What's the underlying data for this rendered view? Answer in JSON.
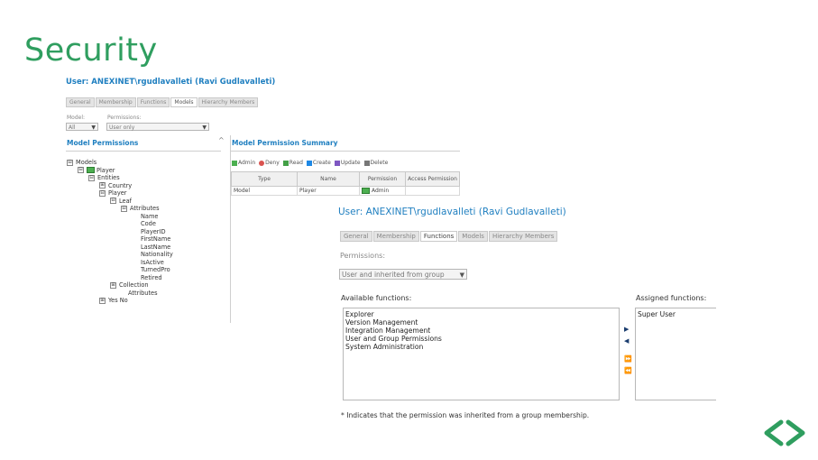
{
  "slide": {
    "title": "Security"
  },
  "screenshot1": {
    "user_title": "User: ANEXINET\\rgudlavalleti (Ravi Gudlavalleti)",
    "tabs": [
      "General",
      "Membership",
      "Functions",
      "Models",
      "Hierarchy Members"
    ],
    "model_label": "Model:",
    "model_value": "All",
    "permissions_label": "Permissions:",
    "permissions_value": "User only",
    "left_title": "Model Permissions",
    "right_title": "Model Permission Summary",
    "legend": [
      {
        "label": "Admin",
        "color": "#4caf50"
      },
      {
        "label": "Deny",
        "color": "#d9534f"
      },
      {
        "label": "Read",
        "color": "#43a047"
      },
      {
        "label": "Create",
        "color": "#1e88e5"
      },
      {
        "label": "Update",
        "color": "#7e57c2"
      },
      {
        "label": "Delete",
        "color": "#777777"
      }
    ],
    "tree": [
      {
        "label": "Models",
        "toggle": "⊟",
        "icon": false
      },
      {
        "label": "Player",
        "toggle": "⊟",
        "icon": true
      },
      {
        "label": "Entities",
        "toggle": "⊟",
        "icon": false
      },
      {
        "label": "Country",
        "toggle": "⊞",
        "icon": false
      },
      {
        "label": "Player",
        "toggle": "⊟",
        "icon": false
      },
      {
        "label": "Leaf",
        "toggle": "⊟",
        "icon": false
      },
      {
        "label": "Attributes",
        "toggle": "⊟",
        "icon": false
      },
      {
        "label": "Name",
        "toggle": "",
        "icon": false
      },
      {
        "label": "Code",
        "toggle": "",
        "icon": false
      },
      {
        "label": "PlayerID",
        "toggle": "",
        "icon": false
      },
      {
        "label": "FirstName",
        "toggle": "",
        "icon": false
      },
      {
        "label": "LastName",
        "toggle": "",
        "icon": false
      },
      {
        "label": "Nationality",
        "toggle": "",
        "icon": false
      },
      {
        "label": "IsActive",
        "toggle": "",
        "icon": false
      },
      {
        "label": "TurnedPro",
        "toggle": "",
        "icon": false
      },
      {
        "label": "Retired",
        "toggle": "",
        "icon": false
      },
      {
        "label": "Collection",
        "toggle": "⊞",
        "icon": false
      },
      {
        "label": "Attributes",
        "toggle": "",
        "icon": false
      },
      {
        "label": "Yes No",
        "toggle": "⊞",
        "icon": false
      }
    ],
    "table": {
      "headers": [
        "Type",
        "Name",
        "Permission",
        "Access Permission"
      ],
      "rows": [
        [
          "Model",
          "Player",
          "Admin",
          ""
        ]
      ]
    }
  },
  "screenshot2": {
    "user_title": "User: ANEXINET\\rgudlavalleti (Ravi Gudlavalleti)",
    "tabs": [
      "General",
      "Membership",
      "Functions",
      "Models",
      "Hierarchy Members"
    ],
    "permissions_label": "Permissions:",
    "permissions_value": "User and inherited from group",
    "available_label": "Available functions:",
    "assigned_label": "Assigned functions:",
    "available": [
      "Explorer",
      "Version Management",
      "Integration Management",
      "User and Group Permissions",
      "System Administration"
    ],
    "assigned": [
      "Super User"
    ],
    "buttons": {
      "add": "▶",
      "remove": "◀",
      "add_all": "⏩",
      "remove_all": "⏪"
    },
    "note": "* Indicates that the permission was inherited from a group membership."
  },
  "nav": {
    "prev_color": "#2f9e5f",
    "next_color": "#2f9e5f"
  }
}
